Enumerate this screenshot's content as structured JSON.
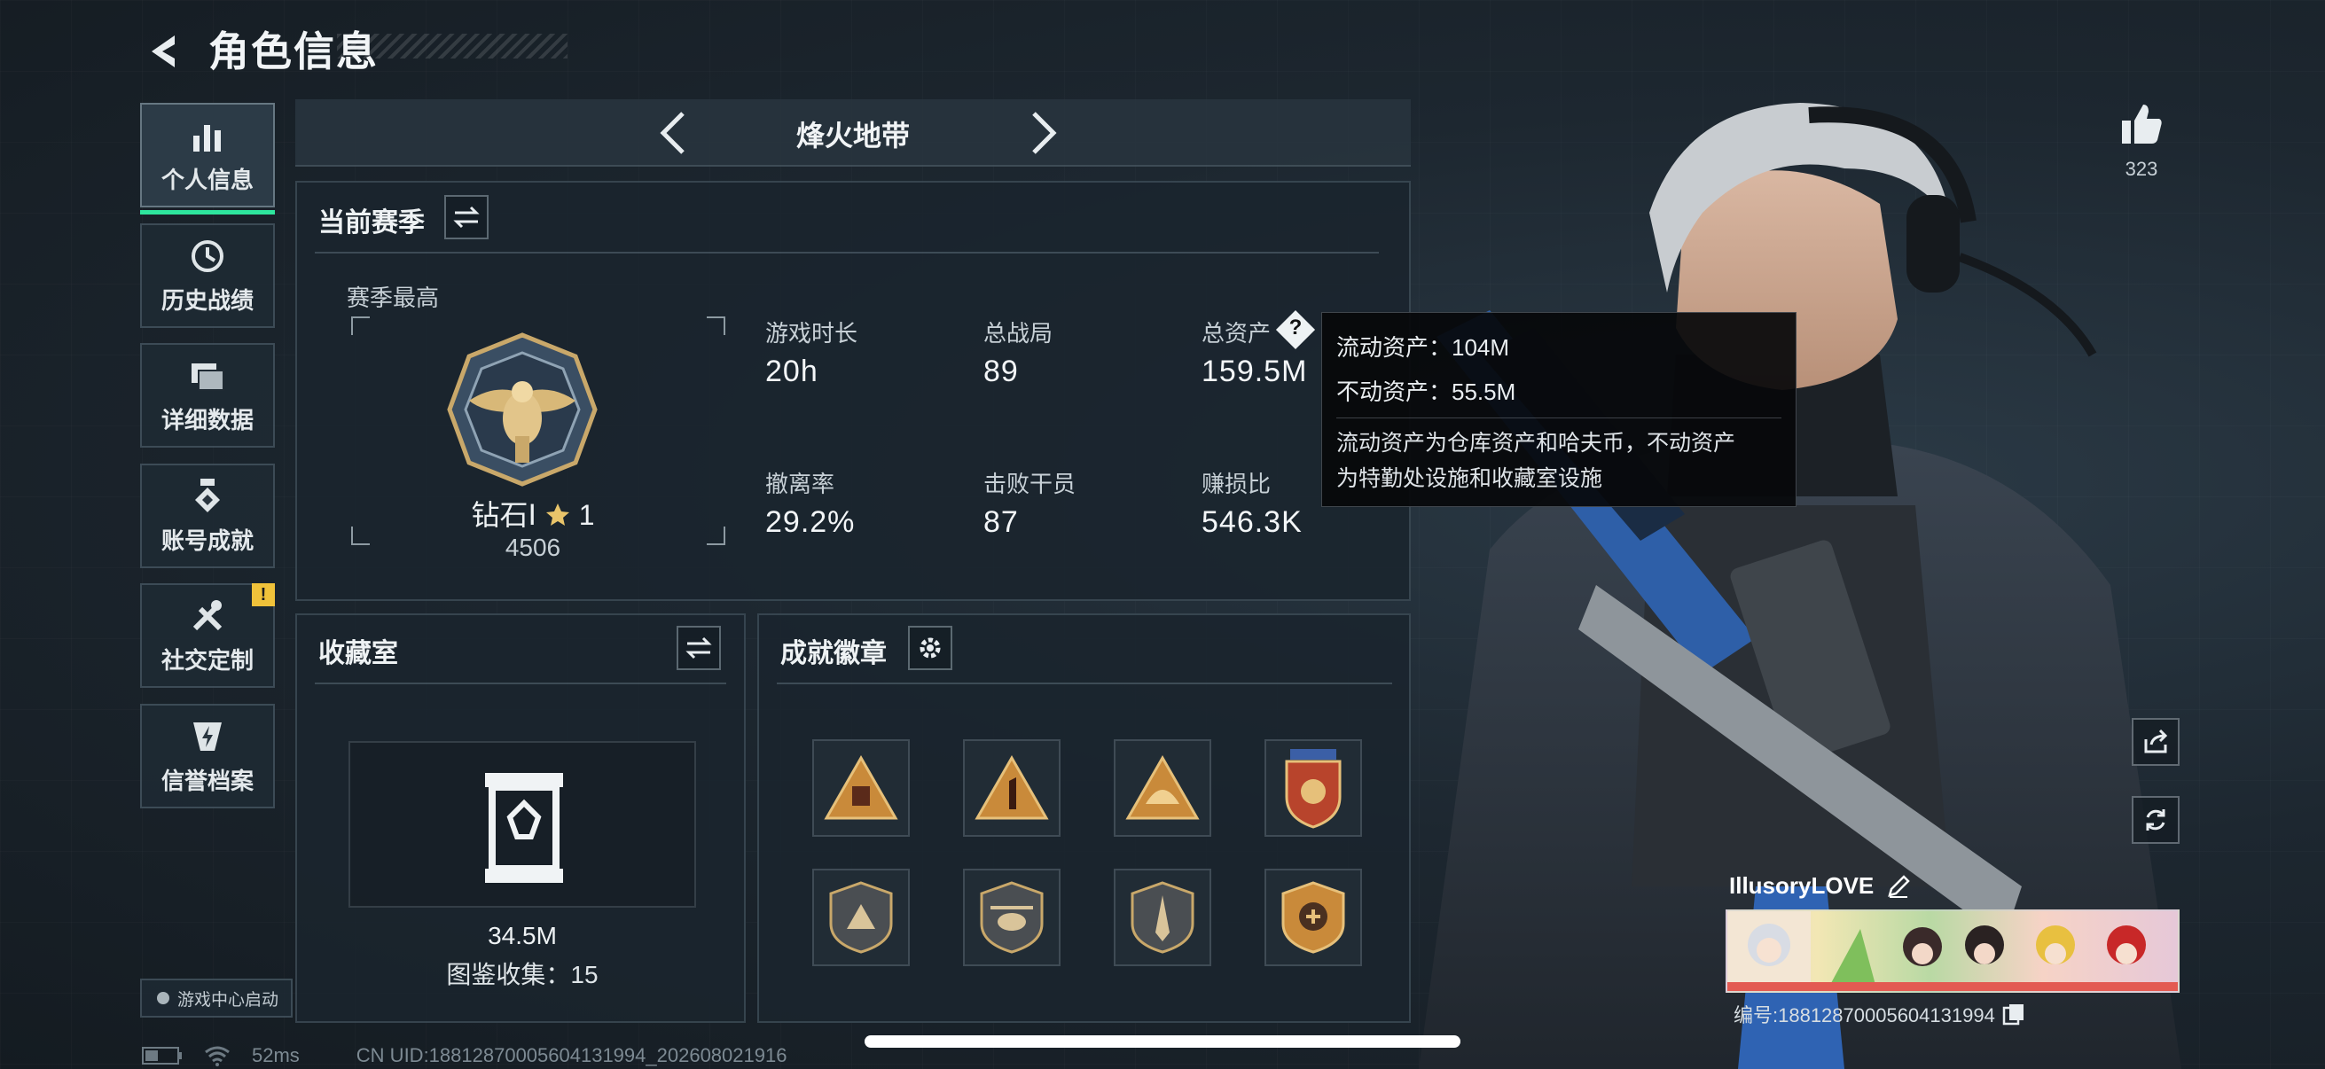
{
  "header": {
    "title": "角色信息"
  },
  "sidebar": {
    "items": [
      {
        "label": "个人信息",
        "icon": "bar-chart-icon",
        "active": true
      },
      {
        "label": "历史战绩",
        "icon": "history-clock-icon"
      },
      {
        "label": "详细数据",
        "icon": "folders-icon"
      },
      {
        "label": "账号成就",
        "icon": "medal-icon"
      },
      {
        "label": "社交定制",
        "icon": "tools-icon",
        "badge": "!"
      },
      {
        "label": "信誉档案",
        "icon": "shield-bolt-icon"
      }
    ],
    "launch_label": "游戏中心启动"
  },
  "mode": {
    "label": "烽火地带"
  },
  "season": {
    "title": "当前赛季",
    "best_label": "赛季最高",
    "rank_name": "钻石Ⅰ",
    "rank_stars": "1",
    "rank_score": "4506",
    "stats": [
      {
        "label": "游戏时长",
        "value": "20h"
      },
      {
        "label": "总战局",
        "value": "89"
      },
      {
        "label": "总资产",
        "value": "159.5M"
      },
      {
        "label": "撤离率",
        "value": "29.2%"
      },
      {
        "label": "击败干员",
        "value": "87"
      },
      {
        "label": "赚损比",
        "value": "546.3K"
      }
    ]
  },
  "tooltip": {
    "liquid": "流动资产：104M",
    "fixed": "不动资产：55.5M",
    "desc_line1": "流动资产为仓库资产和哈夫币，不动资产",
    "desc_line2": "为特勤处设施和收藏室设施"
  },
  "collection": {
    "title": "收藏室",
    "value": "34.5M",
    "count_text": "图鉴收集：15"
  },
  "achievements": {
    "title": "成就徽章",
    "badges": [
      "triangle-crate-badge",
      "triangle-one-badge",
      "triangle-helmet-badge",
      "shield-stars-badge",
      "shield-triangle-badge",
      "shield-helicopter-badge",
      "shield-blade-badge",
      "shield-emblem-badge"
    ]
  },
  "profile": {
    "likes": "323",
    "player_name": "IllusoryLOVE",
    "uid_text": "编号:18812870005604131994"
  },
  "status": {
    "ping": "52ms",
    "cn_uid": "CN UID:18812870005604131994_202608021916"
  },
  "colors": {
    "accent_green": "#2ee59d",
    "warn_yellow": "#f0c23a",
    "gold": "#c9a86a"
  }
}
